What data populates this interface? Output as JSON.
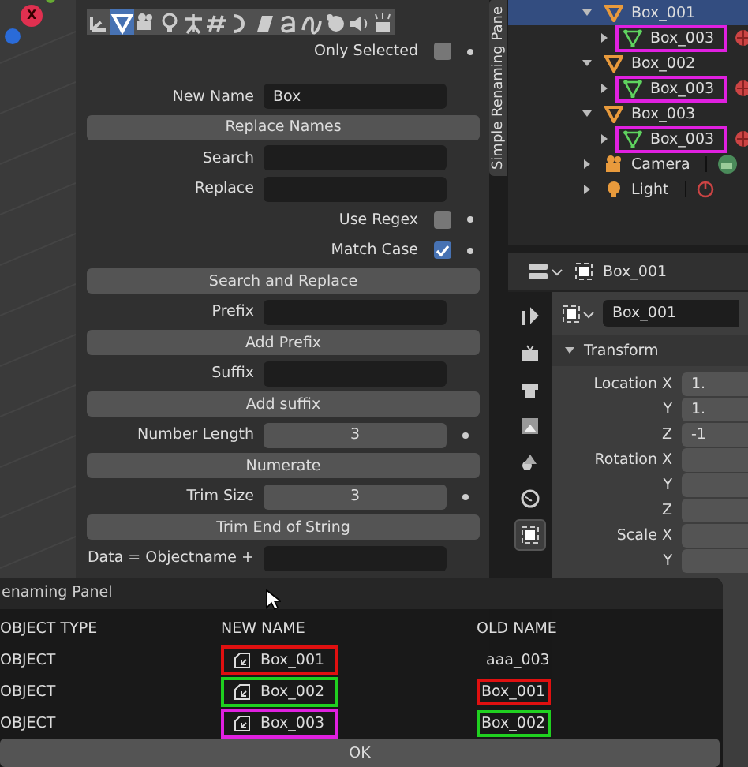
{
  "viewport": {
    "axis_label": "X"
  },
  "panel": {
    "tab_label": "Simple Renaming Pane",
    "type_filters": [
      {
        "selected": false
      },
      {
        "selected": true
      },
      {
        "selected": false
      },
      {
        "selected": false
      },
      {
        "selected": false
      },
      {
        "selected": false
      },
      {
        "selected": false
      },
      {
        "selected": false
      },
      {
        "selected": false
      },
      {
        "selected": false
      },
      {
        "selected": false
      },
      {
        "selected": false
      },
      {
        "selected": false
      }
    ],
    "rows": [
      {
        "kind": "checkbox",
        "label": "Only Selected",
        "checked": false
      },
      {
        "kind": "field",
        "label": "New Name",
        "value": "Box"
      },
      {
        "kind": "button",
        "label": "Replace Names"
      },
      {
        "kind": "field",
        "label": "Search"
      },
      {
        "kind": "field",
        "label": "Replace"
      },
      {
        "kind": "checkbox",
        "label": "Use Regex",
        "checked": false
      },
      {
        "kind": "checkbox",
        "label": "Match Case",
        "checked": true
      },
      {
        "kind": "button",
        "label": "Search and Replace"
      },
      {
        "kind": "field",
        "label": "Prefix"
      },
      {
        "kind": "button",
        "label": "Add Prefix"
      },
      {
        "kind": "field",
        "label": "Suffix"
      },
      {
        "kind": "button",
        "label": "Add suffix"
      },
      {
        "kind": "number",
        "label": "Number Length",
        "value": "3"
      },
      {
        "kind": "button",
        "label": "Numerate"
      },
      {
        "kind": "number",
        "label": "Trim Size",
        "value": "3"
      },
      {
        "kind": "button",
        "label": "Trim End of String"
      },
      {
        "kind": "field",
        "label": "Data = Objectname +"
      }
    ]
  },
  "outliner": {
    "items": [
      {
        "kind": "mesh_object",
        "name": "Box_001",
        "selected": true,
        "expanded": true,
        "children": [
          {
            "kind": "mesh_data",
            "name": "Box_003",
            "selected": false,
            "expanded": false,
            "color": "#e020e0"
          }
        ]
      },
      {
        "kind": "mesh_object",
        "name": "Box_002",
        "selected": false,
        "expanded": true,
        "children": [
          {
            "kind": "mesh_data",
            "name": "Box_003",
            "selected": false,
            "expanded": false,
            "color": "#e020e0"
          }
        ]
      },
      {
        "kind": "mesh_object",
        "name": "Box_003",
        "selected": false,
        "expanded": true,
        "children": [
          {
            "kind": "mesh_data",
            "name": "Box_003",
            "selected": false,
            "expanded": false,
            "color": "#e020e0"
          }
        ]
      },
      {
        "kind": "camera",
        "name": "Camera",
        "selected": false,
        "expanded": false
      },
      {
        "kind": "light",
        "name": "Light",
        "selected": false,
        "expanded": false
      }
    ]
  },
  "properties": {
    "header_name": "Box_001",
    "object_field": "Box_001",
    "tabs": [
      {
        "selected": false
      },
      {
        "selected": false
      },
      {
        "selected": false
      },
      {
        "selected": false
      },
      {
        "selected": false
      },
      {
        "selected": false
      },
      {
        "selected": true
      }
    ],
    "section": {
      "title": "Transform",
      "expanded": true
    },
    "rows": [
      {
        "label": "Location X",
        "value": "1."
      },
      {
        "label": "Y",
        "value": "1."
      },
      {
        "label": "Z",
        "value": "-1"
      },
      {
        "label": "Rotation X"
      },
      {
        "label": "Y"
      },
      {
        "label": "Z"
      },
      {
        "label": "Scale X"
      },
      {
        "label": "Y"
      }
    ]
  },
  "dialog": {
    "title": "enaming Panel",
    "columns": [
      "OBJECT TYPE",
      "NEW NAME",
      "OLD NAME"
    ],
    "rows": [
      {
        "type": "OBJECT",
        "new_name": {
          "text": "Box_001",
          "color": "#e01010"
        },
        "old_name": {
          "text": "aaa_003"
        }
      },
      {
        "type": "OBJECT",
        "new_name": {
          "text": "Box_002",
          "color": "#20d020"
        },
        "old_name": {
          "text": "Box_001",
          "color": "#e01010"
        }
      },
      {
        "type": "OBJECT",
        "new_name": {
          "text": "Box_003",
          "color": "#e020e0"
        },
        "old_name": {
          "text": "Box_002",
          "color": "#20d020"
        }
      }
    ],
    "ok_label": "OK"
  }
}
